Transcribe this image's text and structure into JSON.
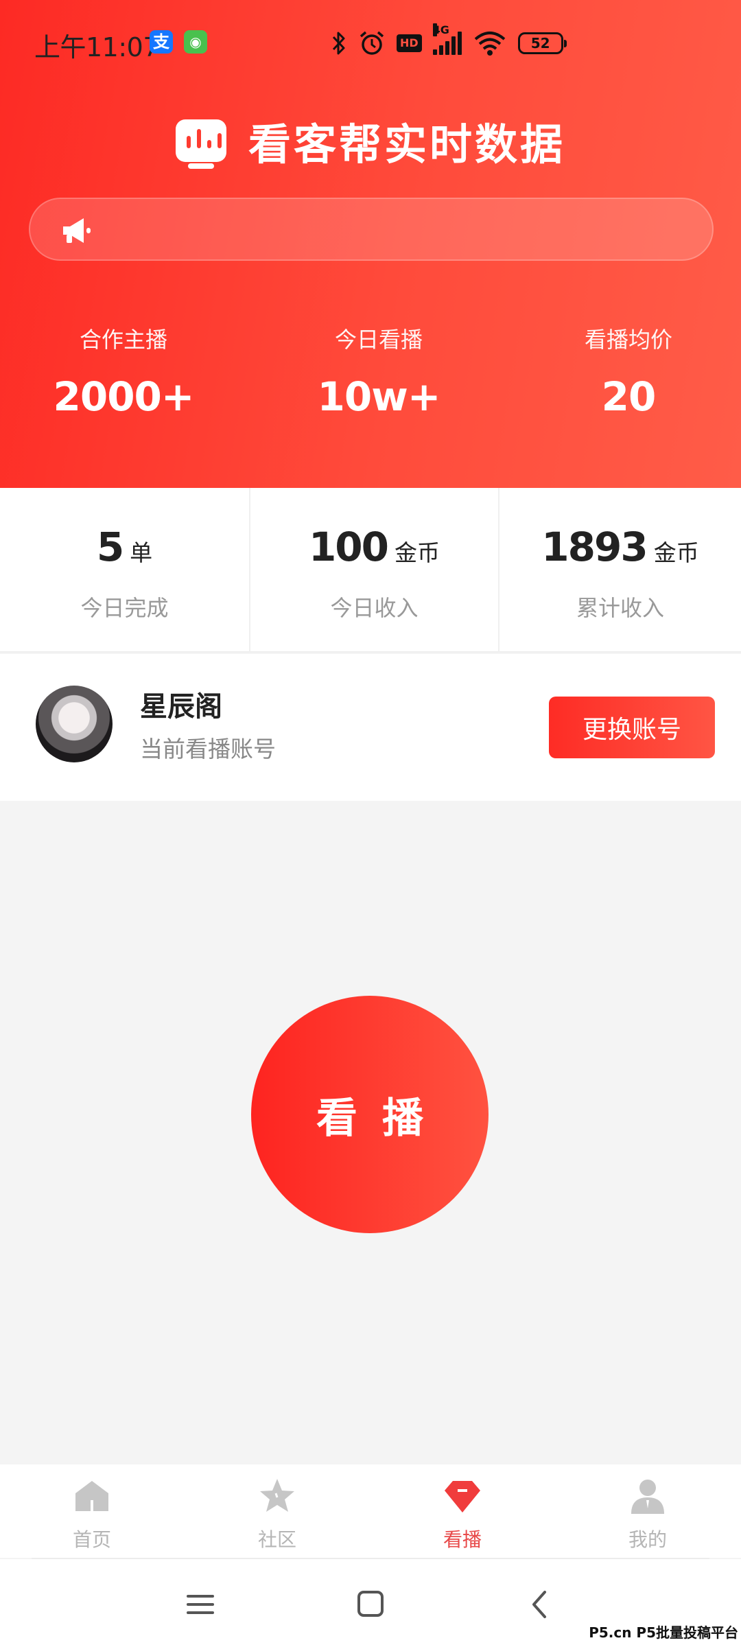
{
  "status_bar": {
    "time": "上午11:07",
    "alipay_glyph": "支",
    "network": "4G",
    "battery": "52"
  },
  "header": {
    "title": "看客帮实时数据",
    "stats": [
      {
        "label": "合作主播",
        "value": "2000+"
      },
      {
        "label": "今日看播",
        "value": "10w+"
      },
      {
        "label": "看播均价",
        "value": "20"
      }
    ]
  },
  "metrics": [
    {
      "value": "5",
      "unit": "单",
      "label": "今日完成"
    },
    {
      "value": "100",
      "unit": "金币",
      "label": "今日收入"
    },
    {
      "value": "1893",
      "unit": "金币",
      "label": "累计收入"
    }
  ],
  "account": {
    "name": "星辰阁",
    "subtitle": "当前看播账号",
    "switch_label": "更换账号"
  },
  "main": {
    "watch_label": "看播"
  },
  "tabs": [
    {
      "label": "首页",
      "icon": "home-icon"
    },
    {
      "label": "社区",
      "icon": "star-icon"
    },
    {
      "label": "看播",
      "icon": "gem-icon",
      "active": true
    },
    {
      "label": "我的",
      "icon": "user-icon"
    }
  ],
  "watermark": "P5.cn P5批量投稿平台",
  "colors": {
    "accent": "#fe2c25",
    "accent_light": "#ff5544",
    "tab_active": "#e84a4a",
    "tab_inactive": "#b5b5b5"
  }
}
